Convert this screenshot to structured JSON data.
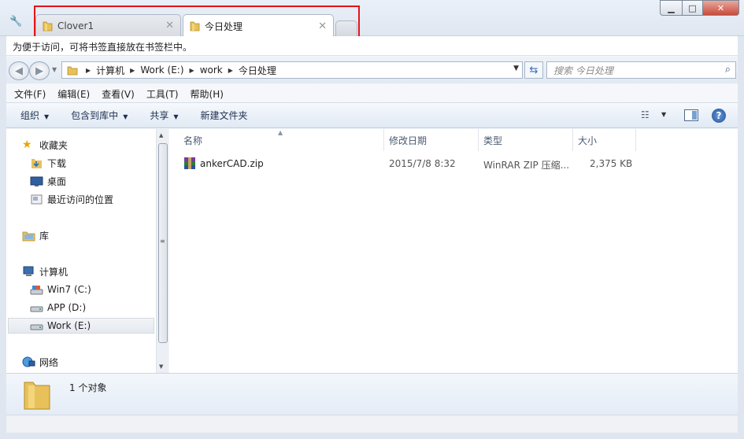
{
  "tabs": [
    {
      "label": "Clover1",
      "active": false
    },
    {
      "label": "今日处理",
      "active": true
    }
  ],
  "window_buttons": {
    "minimize": "▁",
    "maximize": "□",
    "close": "✕"
  },
  "hint_bar": "为便于访问，可将书签直接放在书签栏中。",
  "address": {
    "crumbs": [
      "计算机",
      "Work (E:)",
      "work",
      "今日处理"
    ],
    "search_placeholder": "搜索 今日处理"
  },
  "menu": [
    "文件(F)",
    "编辑(E)",
    "查看(V)",
    "工具(T)",
    "帮助(H)"
  ],
  "toolbar": {
    "organize": "组织",
    "include_library": "包含到库中",
    "share": "共享",
    "new_folder": "新建文件夹"
  },
  "nav": {
    "favorites": "收藏夹",
    "downloads": "下载",
    "desktop": "桌面",
    "recent": "最近访问的位置",
    "libraries": "库",
    "computer": "计算机",
    "drive_c": "Win7 (C:)",
    "drive_d": "APP (D:)",
    "drive_e": "Work (E:)",
    "network": "网络"
  },
  "columns": {
    "name": "名称",
    "modified": "修改日期",
    "type": "类型",
    "size": "大小"
  },
  "files": [
    {
      "name": "ankerCAD.zip",
      "modified": "2015/7/8 8:32",
      "type": "WinRAR ZIP 压缩...",
      "size": "2,375 KB"
    }
  ],
  "details": {
    "count": "1 个对象"
  },
  "colors": {
    "highlight_box": "#e3141a",
    "folder": "#e8c15a"
  }
}
